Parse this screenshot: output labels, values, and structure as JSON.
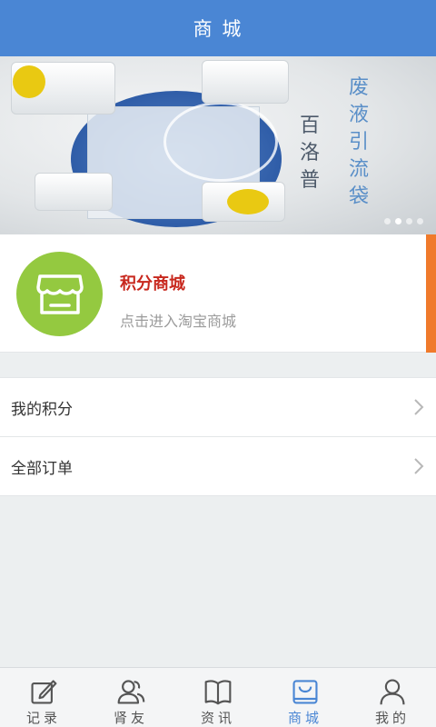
{
  "header": {
    "title": "商 城"
  },
  "banner": {
    "brand": "百洛普",
    "product": "废液引流袋",
    "slides": 4,
    "active_slide": 2
  },
  "store": {
    "title": "积分商城",
    "subtitle": "点击进入淘宝商城",
    "icon": "store-icon",
    "accent_color": "#f07a2b",
    "icon_bg": "#94c940"
  },
  "list": [
    {
      "label": "我的积分"
    },
    {
      "label": "全部订单"
    }
  ],
  "tabs": [
    {
      "label": "记录",
      "icon": "record-icon"
    },
    {
      "label": "肾友",
      "icon": "friends-icon"
    },
    {
      "label": "资讯",
      "icon": "news-icon"
    },
    {
      "label": "商城",
      "icon": "mall-icon",
      "active": true
    },
    {
      "label": "我的",
      "icon": "profile-icon"
    }
  ],
  "colors": {
    "primary": "#4a86d4",
    "title_red": "#c8281e"
  }
}
